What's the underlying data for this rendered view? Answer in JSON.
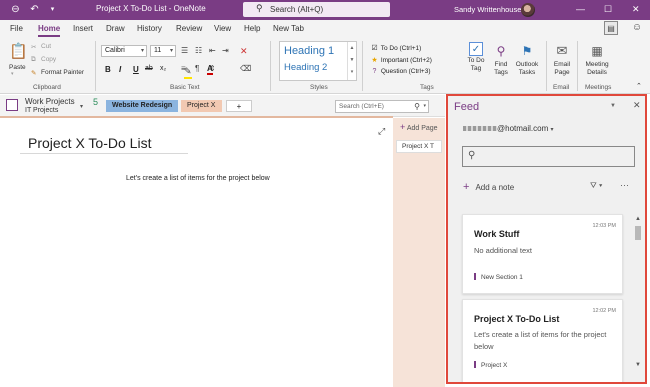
{
  "titlebar": {
    "doc_title": "Project X To-Do List  -  OneNote",
    "search_text": "Search (Alt+Q)",
    "user_name": "Sandy Writtenhouse",
    "back_icon": "back-icon",
    "undo_icon": "undo-icon",
    "qat_icon": "qat-dropdown-icon"
  },
  "menu_tabs": [
    "File",
    "Home",
    "Insert",
    "Draw",
    "History",
    "Review",
    "View",
    "Help",
    "New Tab"
  ],
  "active_tab": "Home",
  "ribbon": {
    "clipboard": {
      "paste": "Paste",
      "cut": "Cut",
      "copy": "Copy",
      "format_painter": "Format Painter",
      "label": "Clipboard"
    },
    "basic_text": {
      "font": "Calibri",
      "size": "11",
      "bold": "B",
      "italic": "I",
      "underline": "U",
      "strike": "ab",
      "subscript": "x₂",
      "font_color": "A",
      "label": "Basic Text"
    },
    "styles": {
      "heading1": "Heading 1",
      "heading2": "Heading 2",
      "label": "Styles"
    },
    "tags": {
      "items": [
        "To Do (Ctrl+1)",
        "Important (Ctrl+2)",
        "Question (Ctrl+3)"
      ],
      "todo_tag": "To Do Tag",
      "find_tags": "Find Tags",
      "outlook_tasks": "Outlook Tasks",
      "label": "Tags"
    },
    "email": {
      "email_page": "Email Page",
      "label": "Email"
    },
    "meetings": {
      "meeting_details": "Meeting Details",
      "label": "Meetings"
    }
  },
  "notebook": {
    "name": "Work Projects",
    "section_group": "IT Projects",
    "badge": "5",
    "sections": [
      "Website Redesign",
      "Project X"
    ],
    "add_section": "+",
    "search_placeholder": "Search (Ctrl+E)"
  },
  "page": {
    "title": "Project X To-Do List",
    "body": "Let's create a list of items for the project below"
  },
  "pagelist": {
    "add_page": "Add Page",
    "pages": [
      "Project X T"
    ]
  },
  "feed": {
    "title": "Feed",
    "account": "@hotmail.com",
    "add_note": "Add a note",
    "cards": [
      {
        "time": "12:03 PM",
        "title": "Work Stuff",
        "body": "No additional text",
        "section": "New Section 1"
      },
      {
        "time": "12:02 PM",
        "title": "Project X To-Do List",
        "body": "Let's create a list of items for the project below",
        "section": "Project X"
      }
    ]
  },
  "colors": {
    "brand": "#7a3c84",
    "feed_border": "#e0483b",
    "section_blue": "#8bb4df",
    "section_orange": "#f2c9b2"
  }
}
